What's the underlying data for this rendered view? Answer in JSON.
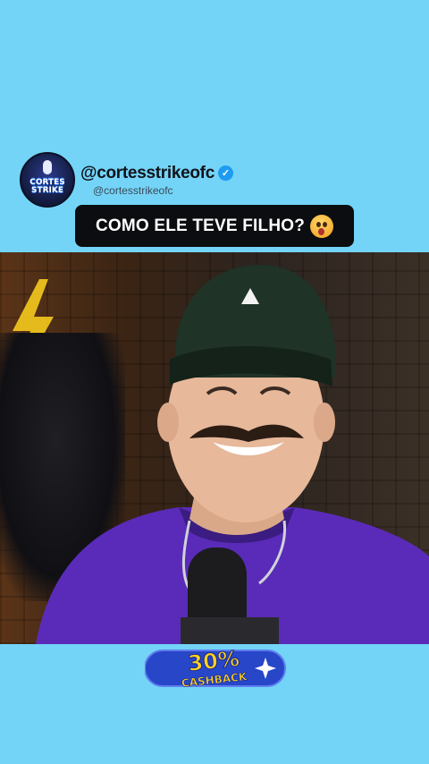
{
  "profile": {
    "handle": "@cortesstrikeofc",
    "subhandle": "@cortesstrikeofc",
    "avatar_logo_line1": "CORTES",
    "avatar_logo_line2": "STRIKE",
    "verified_icon": "verified-check-icon"
  },
  "caption": {
    "text": "COMO ELE TEVE FILHO?",
    "emoji": "astonished-face-emoji"
  },
  "banner": {
    "percent": "30%",
    "label": "CASHBACK",
    "icon": "sparkle-icon"
  },
  "colors": {
    "background": "#73d4f7",
    "caption_bg": "#0b0d10",
    "verified": "#1d9bf0",
    "banner_blue": "#2846c8",
    "banner_yellow": "#ffd21f",
    "shirt_purple": "#5a2bb8"
  }
}
